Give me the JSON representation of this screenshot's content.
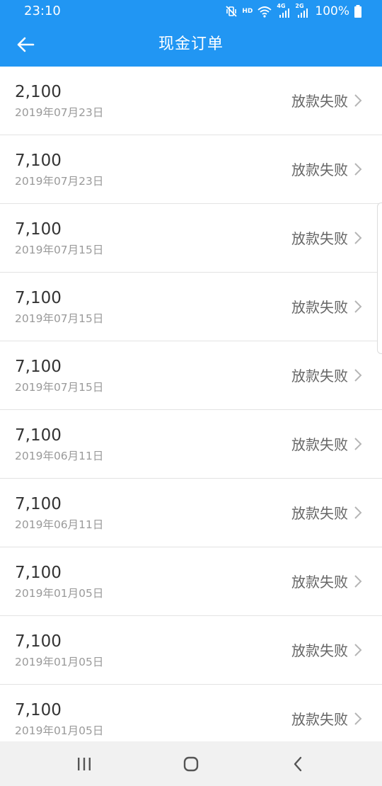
{
  "status_bar": {
    "time": "23:10",
    "hd_label": "HD",
    "net_4g_label": "4G",
    "net_2g_label": "2G",
    "battery_text": "100%",
    "icons": [
      "mute-vibrate-icon",
      "wifi-icon",
      "signal-4g-icon",
      "signal-2g-icon",
      "battery-icon"
    ]
  },
  "app_bar": {
    "title": "现金订单",
    "back_icon": "arrow-left-icon"
  },
  "orders": [
    {
      "amount": "2,100",
      "date": "2019年07月23日",
      "status": "放款失败"
    },
    {
      "amount": "7,100",
      "date": "2019年07月23日",
      "status": "放款失败"
    },
    {
      "amount": "7,100",
      "date": "2019年07月15日",
      "status": "放款失败"
    },
    {
      "amount": "7,100",
      "date": "2019年07月15日",
      "status": "放款失败"
    },
    {
      "amount": "7,100",
      "date": "2019年07月15日",
      "status": "放款失败"
    },
    {
      "amount": "7,100",
      "date": "2019年06月11日",
      "status": "放款失败"
    },
    {
      "amount": "7,100",
      "date": "2019年06月11日",
      "status": "放款失败"
    },
    {
      "amount": "7,100",
      "date": "2019年01月05日",
      "status": "放款失败"
    },
    {
      "amount": "7,100",
      "date": "2019年01月05日",
      "status": "放款失败"
    },
    {
      "amount": "7,100",
      "date": "2019年01月05日",
      "status": "放款失败"
    }
  ],
  "nav_bar": {
    "icons": [
      "recent-apps-icon",
      "home-icon",
      "back-icon"
    ]
  },
  "colors": {
    "primary": "#2196f3",
    "amount_text": "#333333",
    "date_text": "#9a9a9a",
    "status_text": "#666666",
    "divider": "#e3e3e3"
  }
}
